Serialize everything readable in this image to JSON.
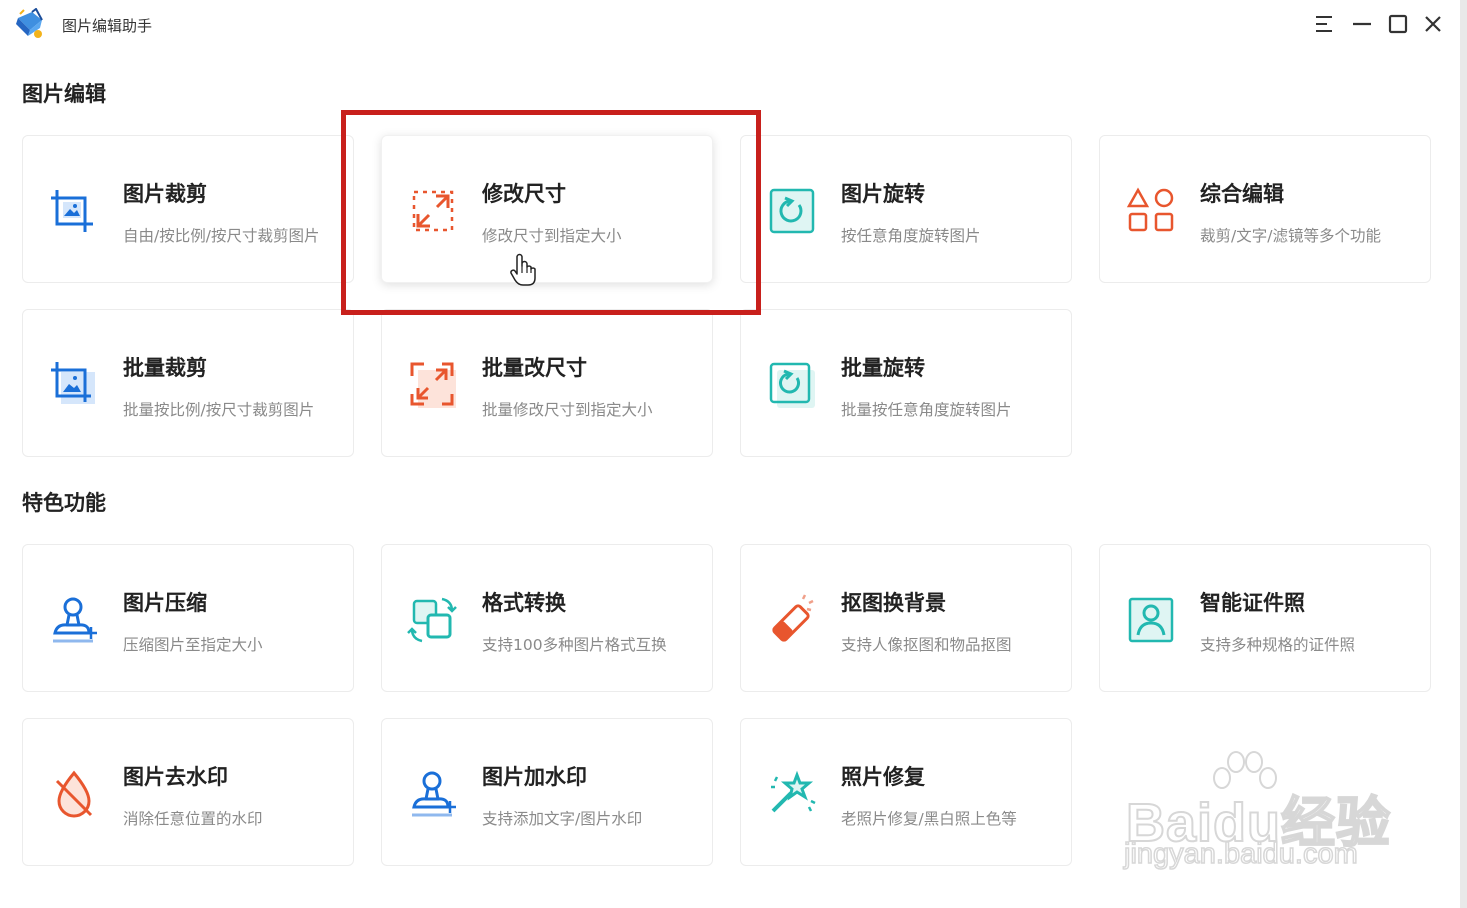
{
  "app": {
    "title": "图片编辑助手",
    "logo_icon": "paint-bucket-logo",
    "window_controls": [
      "menu-icon",
      "minimize-icon",
      "maximize-icon",
      "close-icon"
    ]
  },
  "sections": [
    {
      "title": "图片编辑"
    },
    {
      "title": "特色功能"
    }
  ],
  "cards": [
    {
      "title": "图片裁剪",
      "desc": "自由/按比例/按尺寸裁剪图片",
      "icon": "crop-icon",
      "color": "#1a6fd8"
    },
    {
      "title": "修改尺寸",
      "desc": "修改尺寸到指定大小",
      "icon": "resize-icon",
      "color": "#e8562e"
    },
    {
      "title": "图片旋转",
      "desc": "按任意角度旋转图片",
      "icon": "rotate-icon",
      "color": "#22b8b0"
    },
    {
      "title": "综合编辑",
      "desc": "裁剪/文字/滤镜等多个功能",
      "icon": "shapes-icon",
      "color": "#e8562e"
    },
    {
      "title": "批量裁剪",
      "desc": "批量按比例/按尺寸裁剪图片",
      "icon": "batch-crop-icon",
      "color": "#1a6fd8"
    },
    {
      "title": "批量改尺寸",
      "desc": "批量修改尺寸到指定大小",
      "icon": "batch-resize-icon",
      "color": "#e8562e"
    },
    {
      "title": "批量旋转",
      "desc": "批量按任意角度旋转图片",
      "icon": "batch-rotate-icon",
      "color": "#22b8b0"
    },
    {
      "title": "图片压缩",
      "desc": "压缩图片至指定大小",
      "icon": "compress-icon",
      "color": "#1a6fd8"
    },
    {
      "title": "格式转换",
      "desc": "支持100多种图片格式互换",
      "icon": "convert-icon",
      "color": "#22b8b0"
    },
    {
      "title": "抠图换背景",
      "desc": "支持人像抠图和物品抠图",
      "icon": "eraser-icon",
      "color": "#e8562e"
    },
    {
      "title": "智能证件照",
      "desc": "支持多种规格的证件照",
      "icon": "id-photo-icon",
      "color": "#22b8b0"
    },
    {
      "title": "图片去水印",
      "desc": "消除任意位置的水印",
      "icon": "remove-watermark-icon",
      "color": "#e8562e"
    },
    {
      "title": "图片加水印",
      "desc": "支持添加文字/图片水印",
      "icon": "add-watermark-icon",
      "color": "#1a6fd8"
    },
    {
      "title": "照片修复",
      "desc": "老照片修复/黑白照上色等",
      "icon": "magic-wand-icon",
      "color": "#22b8b0"
    }
  ],
  "watermark": {
    "main": "Baidu经验",
    "sub": "jingyan.baidu.com"
  },
  "colors": {
    "highlight": "#c8201c",
    "blue": "#1a6fd8",
    "orange": "#e8562e",
    "teal": "#22b8b0"
  }
}
